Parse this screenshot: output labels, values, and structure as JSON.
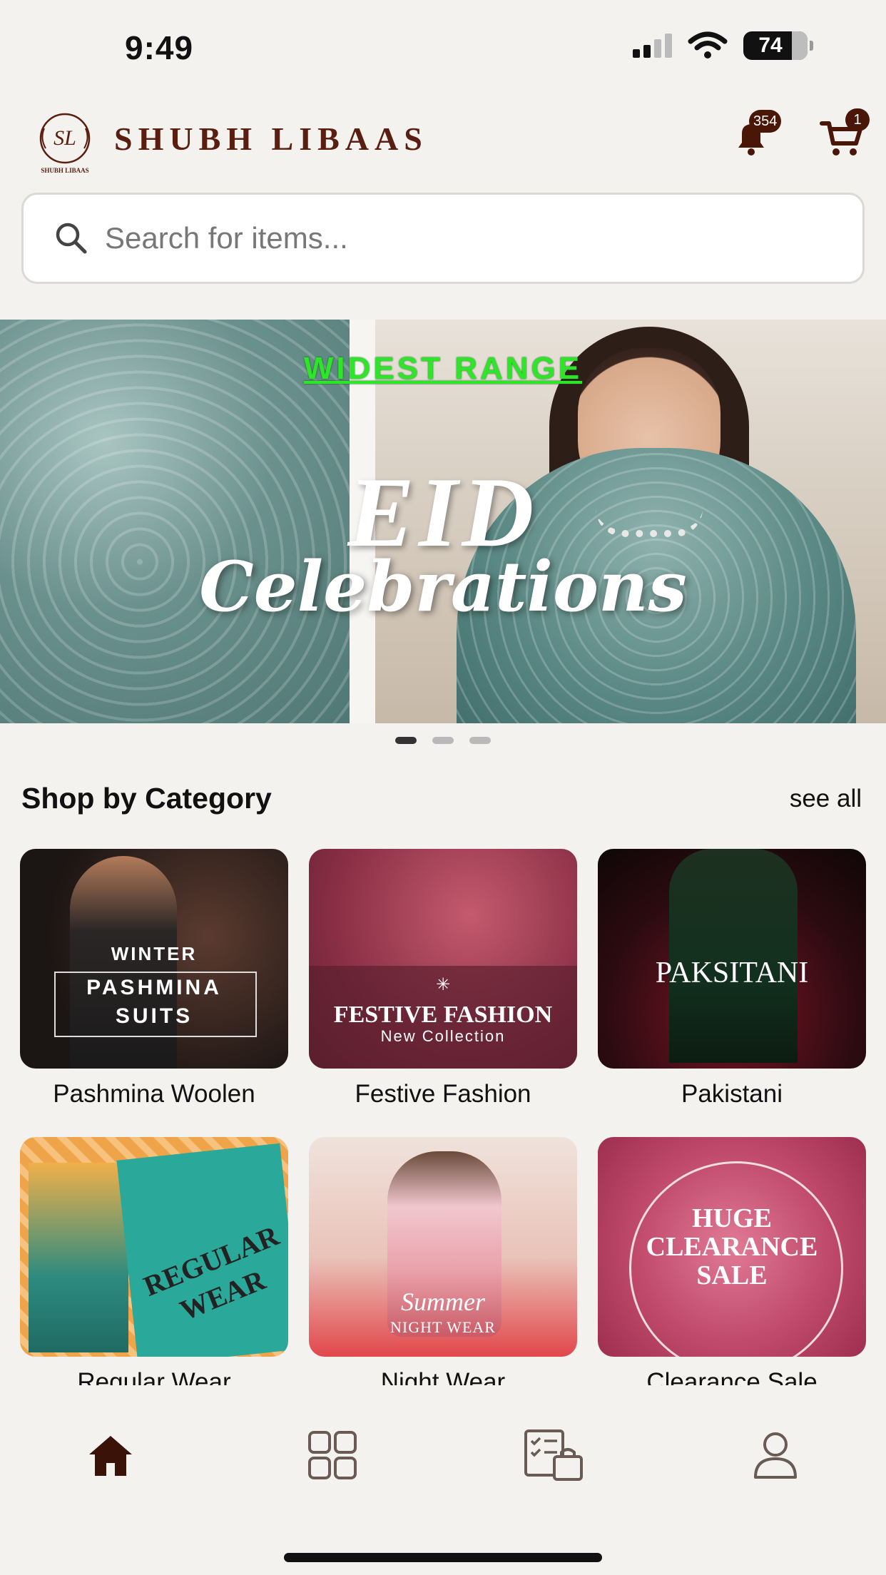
{
  "status_bar": {
    "time": "9:49",
    "battery": "74"
  },
  "header": {
    "brand": "SHUBH LIBAAS",
    "logo_initials": "SL",
    "logo_caption": "SHUBH LIBAAS",
    "notification_count": "354",
    "cart_count": "1"
  },
  "search": {
    "placeholder": "Search for items..."
  },
  "banner": {
    "tagline": "WIDEST RANGE",
    "title": "EID",
    "subtitle": "Celebrations",
    "slides": 3,
    "active_slide": 1
  },
  "categories_section": {
    "title": "Shop by Category",
    "see_all": "see all",
    "items": [
      {
        "label": "Pashmina Woolen",
        "tile_text": [
          "WINTER",
          "PASHMINA",
          "SUITS"
        ]
      },
      {
        "label": "Festive Fashion",
        "tile_text": [
          "FESTIVE FASHION",
          "New Collection"
        ]
      },
      {
        "label": "Pakistani",
        "tile_text": [
          "PAKSITANI"
        ]
      },
      {
        "label": "Regular Wear",
        "tile_text": [
          "REGULAR",
          "WEAR"
        ]
      },
      {
        "label": "Night Wear",
        "tile_text": [
          "Summer",
          "NIGHT WEAR"
        ]
      },
      {
        "label": "Clearance Sale",
        "tile_text": [
          "HUGE",
          "CLEARANCE",
          "SALE"
        ]
      }
    ]
  },
  "bottom_nav": {
    "items": [
      {
        "icon": "home-icon",
        "active": true
      },
      {
        "icon": "grid-icon",
        "active": false
      },
      {
        "icon": "orders-icon",
        "active": false
      },
      {
        "icon": "profile-icon",
        "active": false
      }
    ]
  },
  "colors": {
    "brand": "#5a1e10",
    "background": "#f3f2ef",
    "accent_green": "#2fe52a"
  }
}
